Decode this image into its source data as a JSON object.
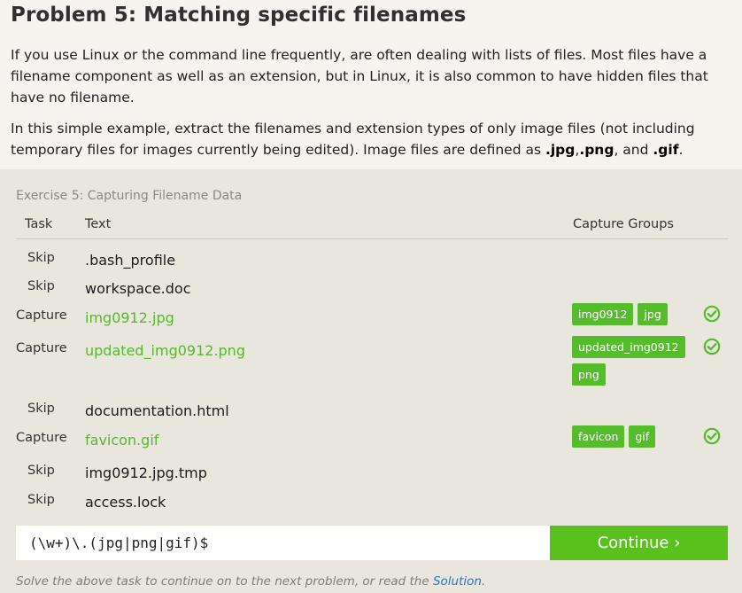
{
  "page": {
    "title": "Problem 5: Matching specific filenames",
    "intro": "If you use Linux or the command line frequently, are often dealing with lists of files. Most files have a filename component as well as an extension, but in Linux, it is also common to have hidden files that have no filename.",
    "instructions_pre": "In this simple example, extract the filenames and extension types of only image files (not including temporary files for images currently being edited). Image files are defined as ",
    "ext_jpg": ".jpg",
    "comma": ",",
    "ext_png": ".png",
    "and_text": ", and ",
    "ext_gif": ".gif",
    "period": "."
  },
  "exercise": {
    "title": "Exercise 5: Capturing Filename Data",
    "headers": {
      "task": "Task",
      "text": "Text",
      "groups": "Capture Groups"
    },
    "rows": [
      {
        "task": "Skip",
        "text": ".bash_profile",
        "groups": []
      },
      {
        "task": "Skip",
        "text": "workspace.doc",
        "groups": []
      },
      {
        "task": "Capture",
        "text": "img0912.jpg",
        "groups": [
          "img0912",
          "jpg"
        ]
      },
      {
        "task": "Capture",
        "text": "updated_img0912.png",
        "groups": [
          "updated_img0912",
          "png"
        ]
      },
      {
        "task": "Skip",
        "text": "documentation.html",
        "groups": []
      },
      {
        "task": "Capture",
        "text": "favicon.gif",
        "groups": [
          "favicon",
          "gif"
        ]
      },
      {
        "task": "Skip",
        "text": "img0912.jpg.tmp",
        "groups": []
      },
      {
        "task": "Skip",
        "text": "access.lock",
        "groups": []
      }
    ],
    "regex_value": "(\\w+)\\.(jpg|png|gif)$",
    "continue_label": "Continue ›",
    "note_pre": "Solve the above task to continue on to the next problem, or read the ",
    "note_link": "Solution",
    "note_post": "."
  },
  "colors": {
    "accent_green": "#59c01e",
    "chip_green": "#55bd2c",
    "link_blue": "#2b73c4",
    "panel_bg": "#e8e6dd"
  },
  "icons": {
    "row_status": "check-circle-icon"
  }
}
